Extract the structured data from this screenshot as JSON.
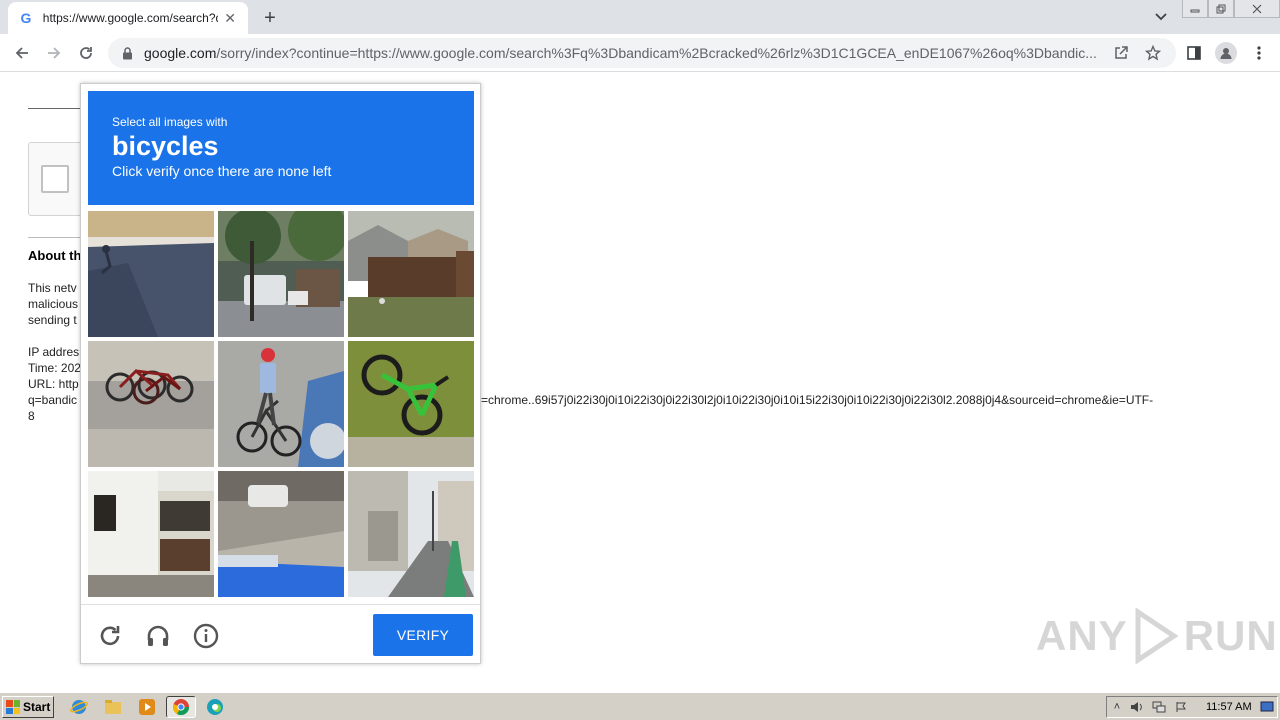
{
  "browser": {
    "tab_title": "https://www.google.com/search?q=",
    "tab_favicon": "G",
    "url_host": "google.com",
    "url_rest": "/sorry/index?continue=https://www.google.com/search%3Fq%3Dbandicam%2Bcracked%26rlz%3D1C1GCEA_enDE1067%26oq%3Dbandic..."
  },
  "page": {
    "about_heading": "About th",
    "para1_line1": "This netv",
    "para1_line2": "malicious",
    "para1_line3": "sending t",
    "ip_line": "IP addres",
    "time_line": "Time: 202",
    "url_line": "URL: http",
    "url_cont_line": "q=bandic",
    "url_tail": "=chrome..69i57j0i22i30j0i10i22i30j0i22i30l2j0i10i22i30j0i10i15i22i30j0i10i22i30j0i22i30l2.2088j0j4&sourceid=chrome&ie=UTF-",
    "url_tail2": "8"
  },
  "captcha": {
    "instruction_line1": "Select all images with",
    "target_object": "bicycles",
    "instruction_line3": "Click verify once there are none left",
    "verify_label": "VERIFY",
    "accent_color": "#1a73e8"
  },
  "watermark": {
    "left": "ANY",
    "right": "RUN"
  },
  "taskbar": {
    "start_label": "Start",
    "clock": "11:57 AM"
  }
}
